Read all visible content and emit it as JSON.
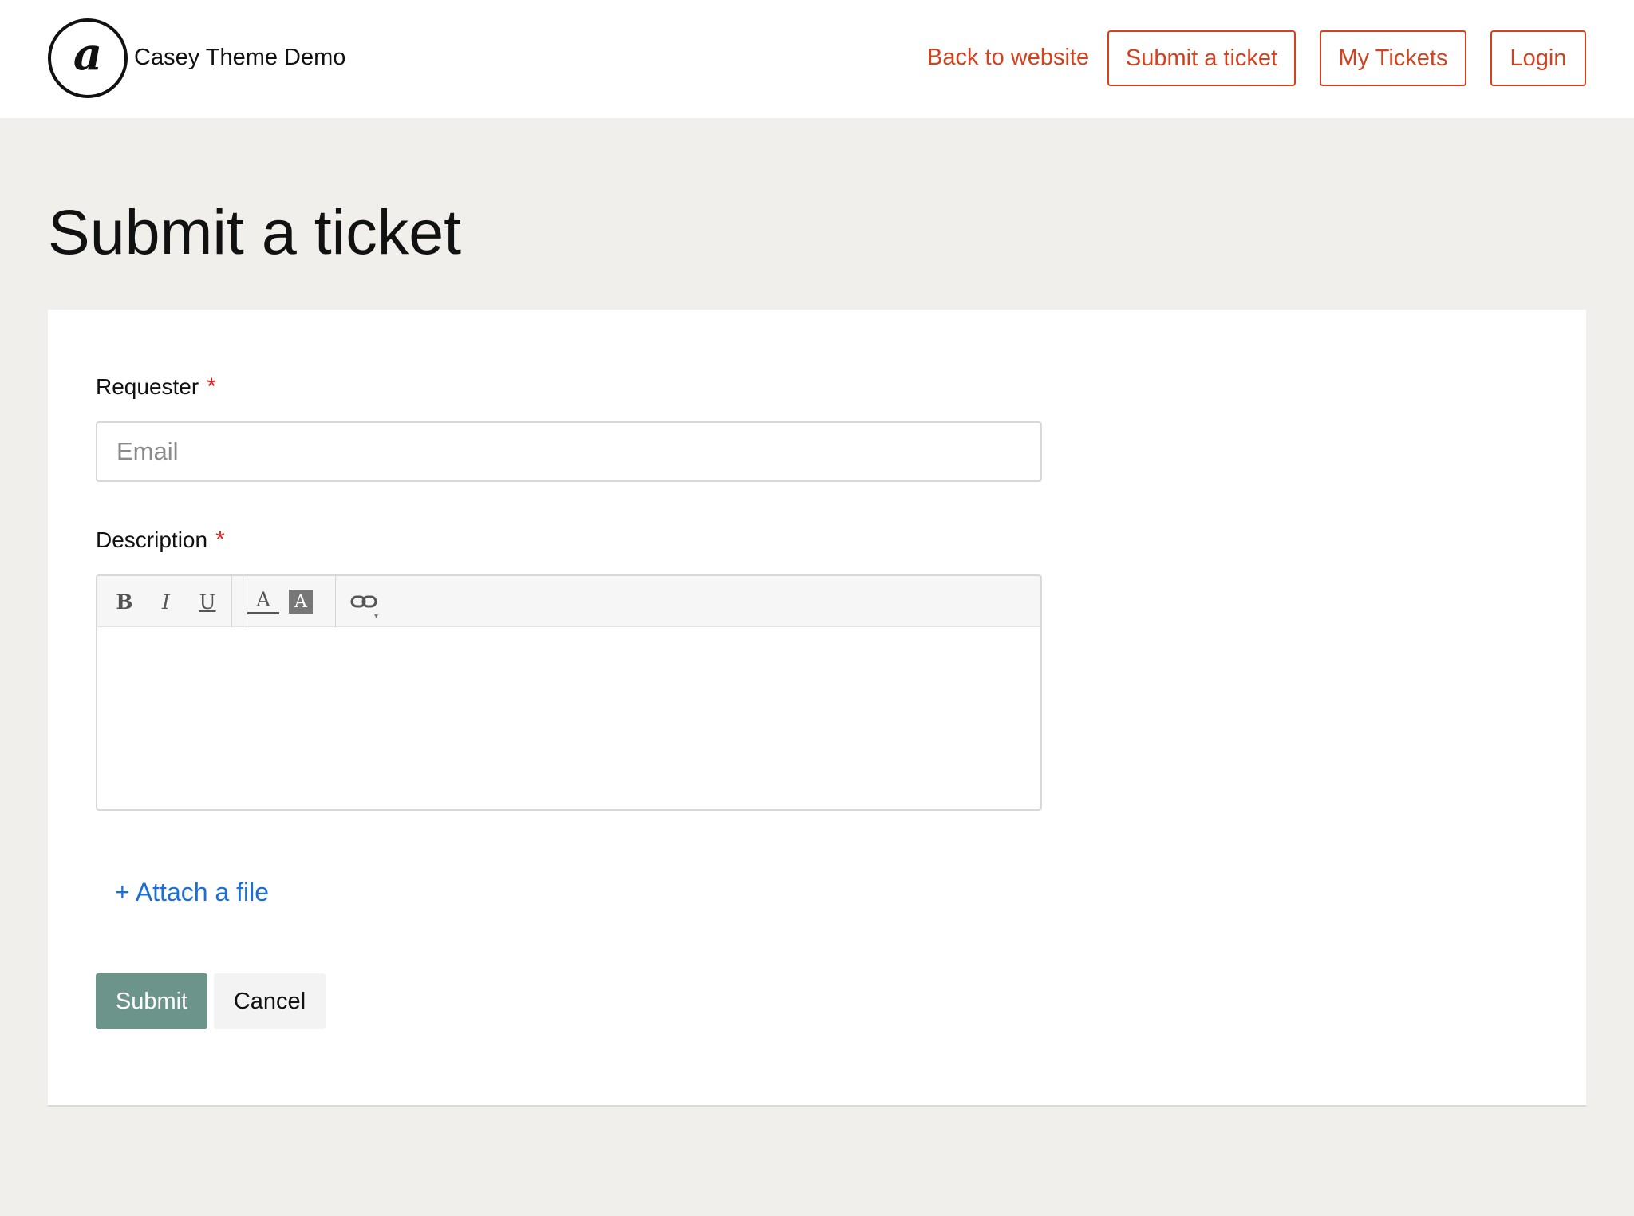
{
  "header": {
    "brand_name": "Casey Theme Demo",
    "logo_glyph": "a",
    "nav": {
      "back_link": "Back to website",
      "submit_ticket": "Submit a ticket",
      "my_tickets": "My Tickets",
      "login": "Login"
    }
  },
  "page": {
    "title": "Submit a ticket"
  },
  "form": {
    "requester": {
      "label": "Requester",
      "required_mark": "*",
      "placeholder": "Email",
      "value": ""
    },
    "description": {
      "label": "Description",
      "required_mark": "*",
      "toolbar": {
        "bold": "B",
        "italic": "I",
        "underline": "U",
        "text_color": "A",
        "background_color": "A",
        "link_icon": "link-icon"
      },
      "value": ""
    },
    "attach_label": "+ Attach a file",
    "submit_label": "Submit",
    "cancel_label": "Cancel"
  },
  "colors": {
    "accent": "#d3411e",
    "link_blue": "#1a6fd6",
    "submit_bg": "#6d948a",
    "page_bg": "#f0efeb",
    "required_red": "#e02020"
  }
}
